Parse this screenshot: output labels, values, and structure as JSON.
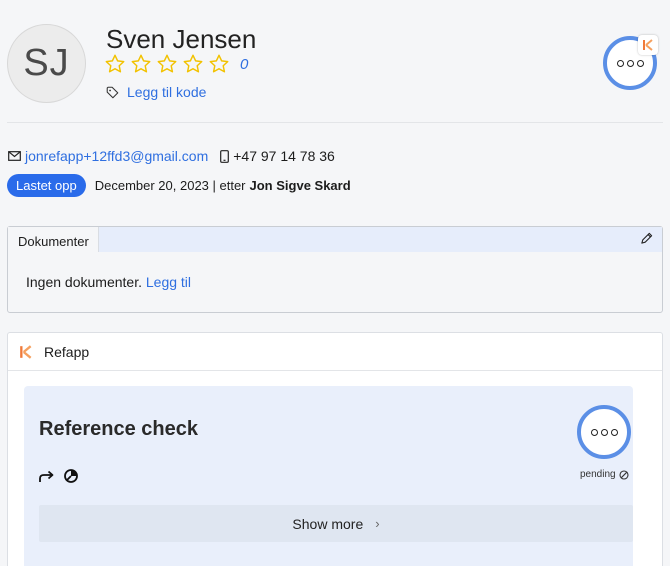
{
  "profile": {
    "initials": "SJ",
    "name": "Sven Jensen",
    "rating_count": "0",
    "tag_link": "Legg til kode"
  },
  "contact": {
    "email": "jonrefapp+12ffd3@gmail.com",
    "phone": "+47 97 14 78 36"
  },
  "status": {
    "pill": "Lastet opp",
    "date_text": "December 20, 2023 | etter",
    "by": "Jon Sigve Skard"
  },
  "documents": {
    "tab": "Dokumenter",
    "empty_text": "Ingen dokumenter.",
    "add_link": "Legg til"
  },
  "refapp": {
    "title": "Refapp",
    "card_title": "Reference check",
    "status": "pending",
    "show_more": "Show more"
  },
  "colors": {
    "accent": "#2f6fe0",
    "pill": "#2a6bea",
    "ring": "#5b8fe6",
    "star": "#f2c200"
  }
}
